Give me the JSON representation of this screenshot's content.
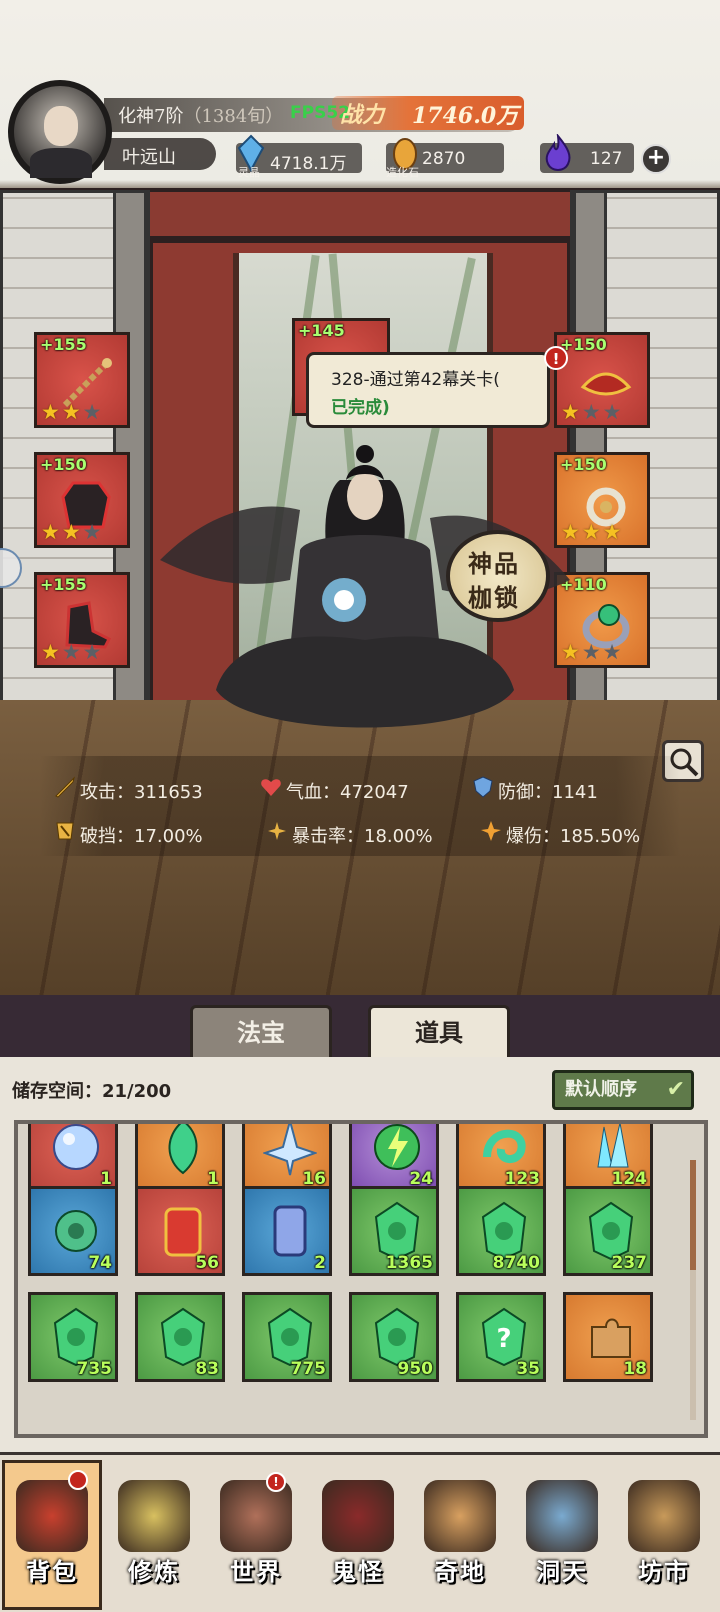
{
  "player": {
    "realm": "化神7阶",
    "age": "（1384旬）",
    "fps": "FPS52",
    "power_label": "战力",
    "power_value": "1746.0万",
    "name": "叶远山"
  },
  "resources": [
    {
      "name": "灵晶",
      "value": "4718.1万",
      "icon": "blue-crystal-icon",
      "color": "#5fb0e8"
    },
    {
      "name": "造化石",
      "value": "2870",
      "icon": "golden-stone-icon",
      "color": "#e8a53a"
    },
    {
      "name": "",
      "value": "127",
      "icon": "purple-flame-icon",
      "color": "#6b3fd0"
    }
  ],
  "equipment_left": [
    {
      "plus": "+155",
      "stars": 2,
      "icon": "chain-whip-icon"
    },
    {
      "plus": "+150",
      "stars": 2,
      "icon": "robe-icon"
    },
    {
      "plus": "+155",
      "stars": 1,
      "icon": "boots-icon"
    }
  ],
  "equipment_right": [
    {
      "plus": "+150",
      "stars": 1,
      "icon": "headband-icon"
    },
    {
      "plus": "+150",
      "stars": 3,
      "icon": "pendant-icon"
    },
    {
      "plus": "+110",
      "stars": 1,
      "icon": "ring-icon"
    }
  ],
  "equipment_top": {
    "plus": "+145"
  },
  "quest": {
    "line1": "328-通过第42幕关卡(",
    "line2": "已完成)",
    "alert": "!"
  },
  "seal": {
    "line1": "神品",
    "line2": "枷锁"
  },
  "stats": [
    {
      "label": "攻击：",
      "value": "311653",
      "icon": "sword-icon"
    },
    {
      "label": "气血：",
      "value": "472047",
      "icon": "heart-icon"
    },
    {
      "label": "防御：",
      "value": "1141",
      "icon": "shield-icon"
    },
    {
      "label": "破挡：",
      "value": "17.00%",
      "icon": "break-icon"
    },
    {
      "label": "暴击率：",
      "value": "18.00%",
      "icon": "crit-icon"
    },
    {
      "label": "爆伤：",
      "value": "185.50%",
      "icon": "crit-damage-icon"
    }
  ],
  "tabs": [
    {
      "label": "法宝",
      "active": false
    },
    {
      "label": "道具",
      "active": true
    }
  ],
  "storage": {
    "label": "储存空间：",
    "value": "21/200"
  },
  "sort": {
    "label": "默认顺序",
    "icon": "chevron-down-icon"
  },
  "items": [
    {
      "count": "1",
      "color": "red",
      "icon": "orb-icon"
    },
    {
      "count": "1",
      "color": "orange",
      "icon": "jade-spirit-icon"
    },
    {
      "count": "16",
      "color": "orange",
      "icon": "ice-crystal-icon"
    },
    {
      "count": "24",
      "color": "purple",
      "icon": "lightning-orb-icon"
    },
    {
      "count": "123",
      "color": "orange",
      "icon": "jade-swirl-icon"
    },
    {
      "count": "124",
      "color": "orange",
      "icon": "crystal-cluster-icon"
    },
    {
      "count": "74",
      "color": "blue",
      "icon": "jade-dragon-icon"
    },
    {
      "count": "56",
      "color": "red",
      "icon": "talisman-icon"
    },
    {
      "count": "2",
      "color": "blue",
      "icon": "blue-talisman-icon"
    },
    {
      "count": "1365",
      "color": "green",
      "icon": "green-gem-icon"
    },
    {
      "count": "8740",
      "color": "green",
      "icon": "green-gem-icon"
    },
    {
      "count": "237",
      "color": "green",
      "icon": "green-gem-icon"
    },
    {
      "count": "735",
      "color": "green",
      "icon": "green-gem-icon"
    },
    {
      "count": "83",
      "color": "green",
      "icon": "green-gem-icon"
    },
    {
      "count": "775",
      "color": "green",
      "icon": "green-gem-icon"
    },
    {
      "count": "950",
      "color": "green",
      "icon": "green-gem-icon"
    },
    {
      "count": "35",
      "color": "green",
      "icon": "mystery-gem-icon"
    },
    {
      "count": "18",
      "color": "orange",
      "icon": "puzzle-piece-icon"
    }
  ],
  "nav": [
    {
      "label": "背包",
      "icon": "backpack-icon",
      "active": true
    },
    {
      "label": "修炼",
      "icon": "lotus-icon",
      "active": false
    },
    {
      "label": "世界",
      "icon": "scroll-map-icon",
      "active": false,
      "alert": "!"
    },
    {
      "label": "鬼怪",
      "icon": "monster-egg-icon",
      "active": false
    },
    {
      "label": "奇地",
      "icon": "mountain-icon",
      "active": false
    },
    {
      "label": "洞天",
      "icon": "portal-icon",
      "active": false
    },
    {
      "label": "坊市",
      "icon": "market-icon",
      "active": false
    }
  ]
}
